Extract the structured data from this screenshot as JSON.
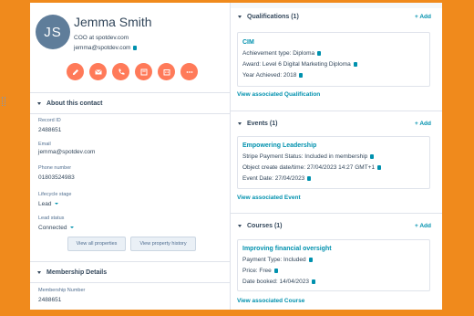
{
  "contact": {
    "initials": "JS",
    "name": "Jemma Smith",
    "title": "COO at spotdev.com",
    "email": "jemma@spotdev.com"
  },
  "actions": [
    {
      "icon": "note-icon",
      "name": "note-action-button"
    },
    {
      "icon": "email-icon",
      "name": "email-action-button"
    },
    {
      "icon": "phone-icon",
      "name": "call-action-button"
    },
    {
      "icon": "task-icon",
      "name": "task-action-button"
    },
    {
      "icon": "calendar-icon",
      "name": "meeting-action-button"
    },
    {
      "icon": "more-icon",
      "name": "more-action-button"
    }
  ],
  "about": {
    "heading": "About this contact",
    "record_id_label": "Record ID",
    "record_id": "2488651",
    "email_label": "Email",
    "email": "jemma@spotdev.com",
    "phone_label": "Phone number",
    "phone": "01803524983",
    "lifecycle_label": "Lifecycle stage",
    "lifecycle": "Lead",
    "lead_status_label": "Lead status",
    "lead_status": "Connected",
    "view_all": "View all properties",
    "view_history": "View property history"
  },
  "membership": {
    "heading": "Membership Details",
    "number_label": "Membership Number",
    "number": "2488651"
  },
  "qualifications": {
    "heading": "Qualifications (1)",
    "add": "+ Add",
    "card_title": "CIM",
    "lines": [
      "Achievement type:  Diploma",
      "Award:  Level 6 Digital Marketing Diploma",
      "Year Achieved:  2018"
    ],
    "view": "View associated Qualification"
  },
  "events": {
    "heading": "Events (1)",
    "add": "+ Add",
    "card_title": "Empowering Leadership",
    "lines": [
      "Stripe Payment Status:  Included in membership",
      "Object create date/time:  27/04/2023 14:27 GMT+1",
      "Event Date:  27/04/2023"
    ],
    "view": "View associated Event"
  },
  "courses": {
    "heading": "Courses (1)",
    "add": "+ Add",
    "card_title": "Improving financial oversight",
    "lines": [
      "Payment Type:  Included",
      "Price:  Free",
      "Date booked:  14/04/2023"
    ],
    "view": "View associated Course"
  },
  "colors": {
    "accent": "#ff7a59",
    "link": "#0091ae",
    "background": "#f08a1c",
    "avatar": "#5f7d9a"
  }
}
